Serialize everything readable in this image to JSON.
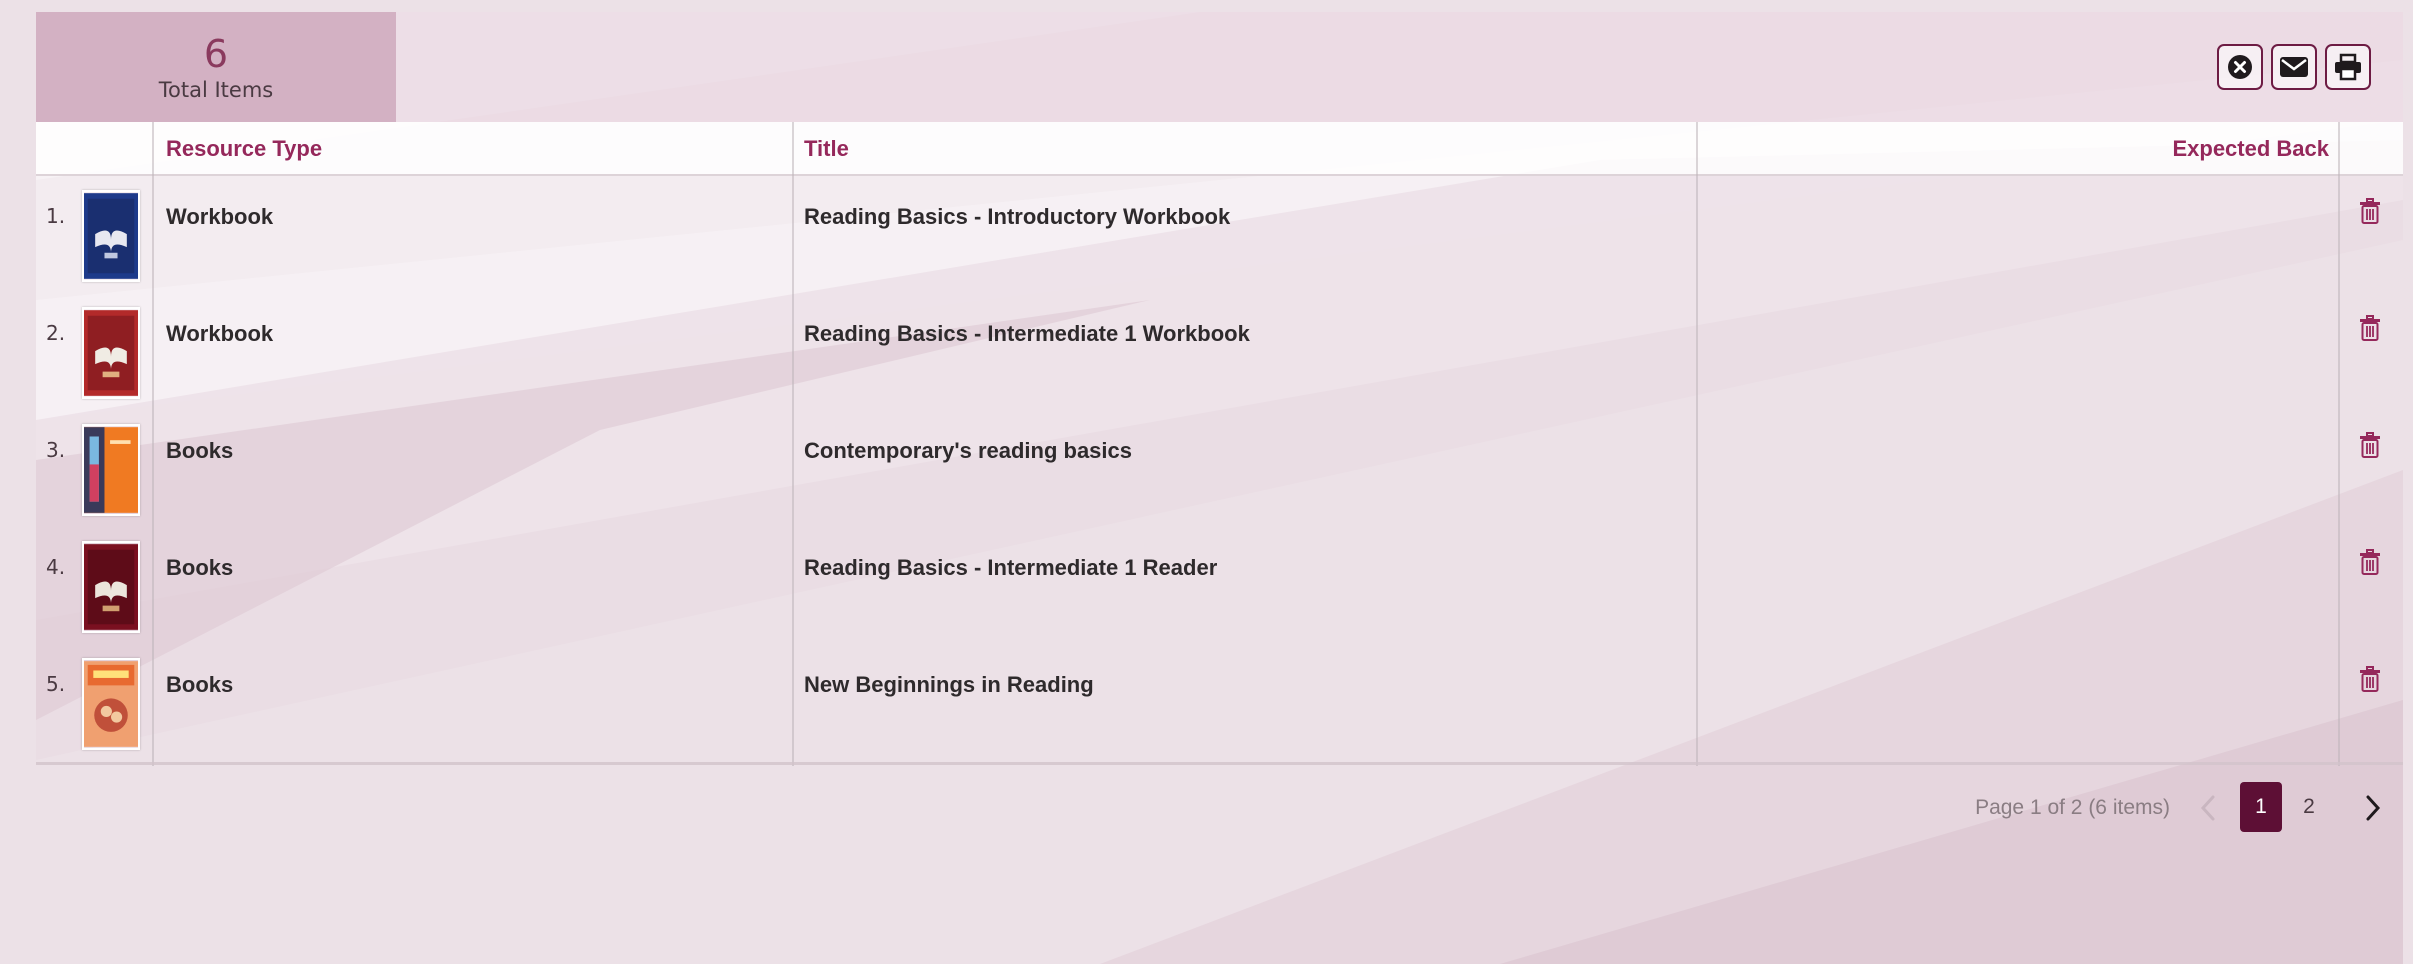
{
  "summary": {
    "total_count": "6",
    "total_label": "Total Items"
  },
  "actions": {
    "clear_icon": "close-circle-icon",
    "email_icon": "envelope-icon",
    "print_icon": "printer-icon"
  },
  "table": {
    "columns": [
      "Resource Type",
      "Title",
      "Expected Back"
    ],
    "rows": [
      {
        "num": "1.",
        "type": "Workbook",
        "title": "Reading Basics - Introductory Workbook",
        "expected_back": "",
        "cover": "blue"
      },
      {
        "num": "2.",
        "type": "Workbook",
        "title": "Reading Basics - Intermediate 1 Workbook",
        "expected_back": "",
        "cover": "red"
      },
      {
        "num": "3.",
        "type": "Books",
        "title": "Contemporary's reading basics",
        "expected_back": "",
        "cover": "orange"
      },
      {
        "num": "4.",
        "type": "Books",
        "title": "Reading Basics - Intermediate 1 Reader",
        "expected_back": "",
        "cover": "darkred"
      },
      {
        "num": "5.",
        "type": "Books",
        "title": "New Beginnings in Reading",
        "expected_back": "",
        "cover": "peach"
      }
    ]
  },
  "pagination": {
    "info": "Page 1 of 2 (6 items)",
    "current_page": "1",
    "next_page_number": "2"
  },
  "colors": {
    "accent": "#95285b",
    "active_page": "#5d0f35",
    "trash": "#95285b"
  }
}
